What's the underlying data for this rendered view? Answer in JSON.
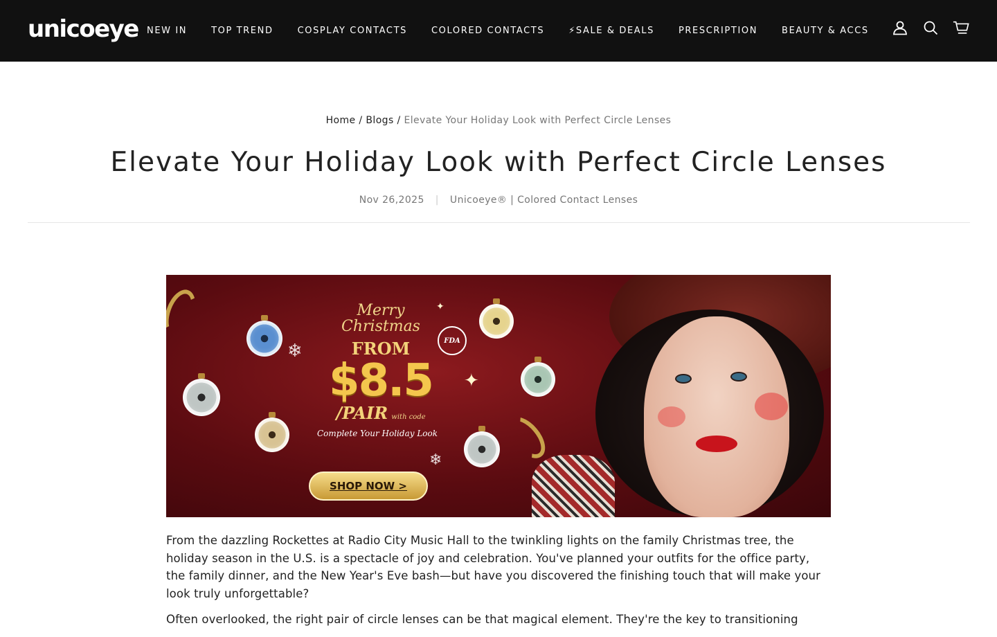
{
  "header": {
    "logo_text": "unicoeye",
    "nav": [
      {
        "label": "NEW IN"
      },
      {
        "label": "TOP TREND"
      },
      {
        "label": "COSPLAY CONTACTS"
      },
      {
        "label": "COLORED CONTACTS"
      },
      {
        "label": "⚡SALE & DEALS"
      },
      {
        "label": "PRESCRIPTION"
      },
      {
        "label": "BEAUTY & ACCS"
      }
    ],
    "icons": [
      "account-icon",
      "search-icon",
      "cart-icon"
    ]
  },
  "breadcrumb": {
    "home": "Home",
    "sep1": " / ",
    "blogs": "Blogs",
    "sep2": " / ",
    "current": "Elevate Your Holiday Look with Perfect Circle Lenses"
  },
  "article": {
    "title": "Elevate Your Holiday Look with Perfect Circle Lenses",
    "date": "Nov 26,2025",
    "separator": "|",
    "author": "Unicoeye® | Colored Contact Lenses",
    "banner": {
      "merry": "Merry",
      "christmas": "Christmas",
      "from": "FROM",
      "price": "$8.5",
      "pair": "/PAIR",
      "with_code": "with code",
      "complete": "Complete Your Holiday Look",
      "fda": "FDA",
      "shop_now": "SHOP NOW >"
    },
    "paragraphs": [
      "From the dazzling Rockettes at Radio City Music Hall to the twinkling lights on the family Christmas tree, the holiday season in the U.S. is a spectacle of joy and celebration. You've planned your outfits for the office party, the family dinner, and the New Year's Eve bash—but have you discovered the finishing touch that will make your look truly unforgettable?",
      "Often overlooked, the right pair of circle lenses can be that magical element. They're the key to transitioning"
    ]
  },
  "colors": {
    "header_bg": "#111111",
    "banner_red": "#5a0b10",
    "gold": "#f4c64d"
  }
}
